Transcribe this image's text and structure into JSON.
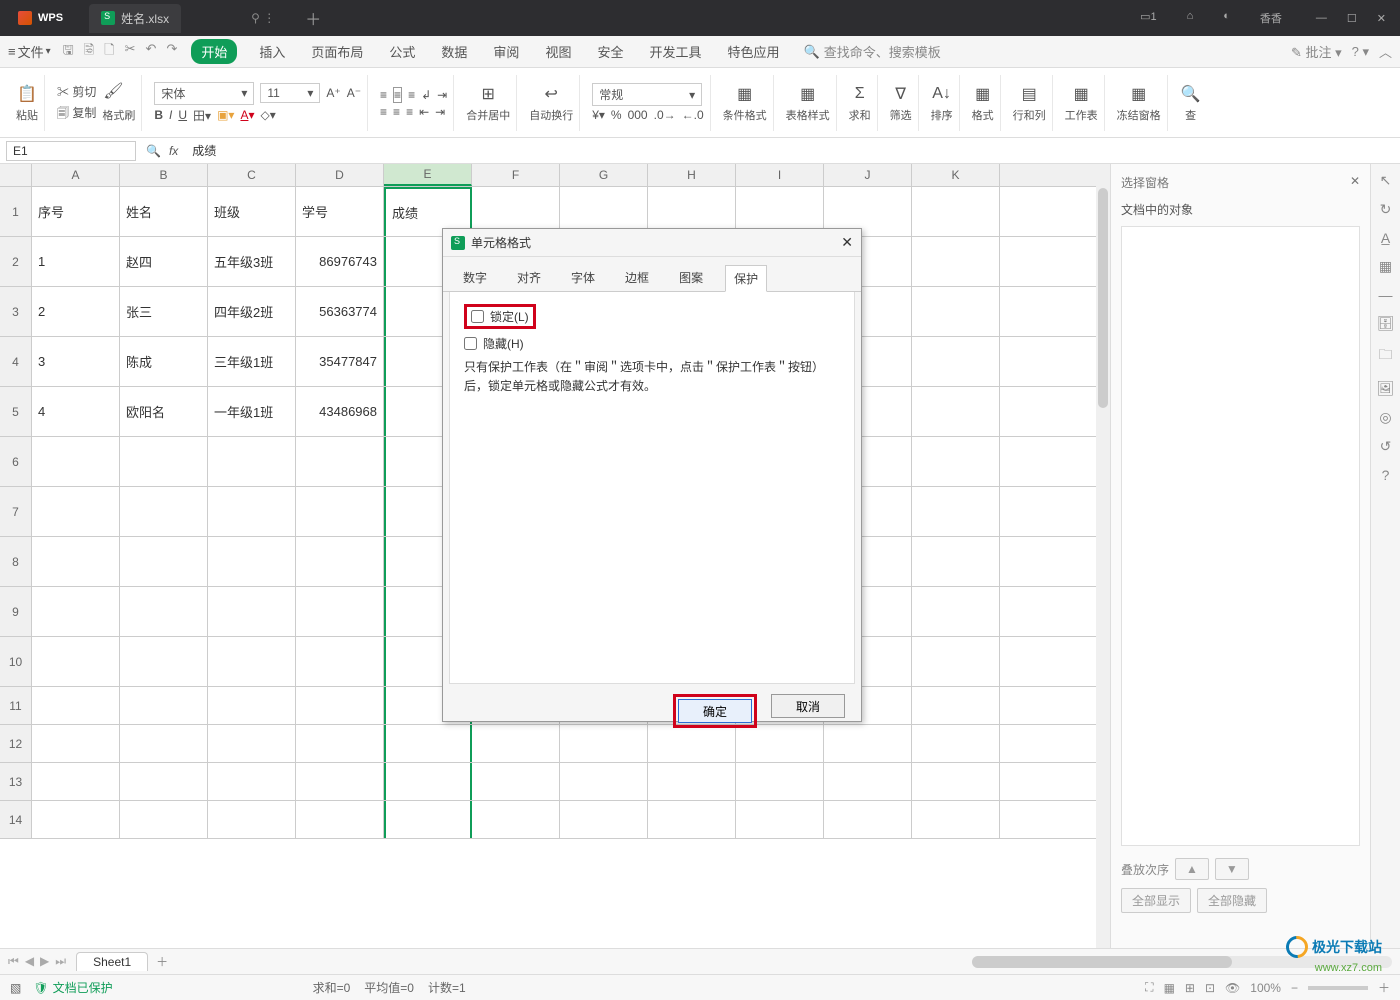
{
  "titlebar": {
    "app": "WPS",
    "filename": "姓名.xlsx",
    "user": "香香"
  },
  "menubar": {
    "file": "文件",
    "tabs": [
      "开始",
      "插入",
      "页面布局",
      "公式",
      "数据",
      "审阅",
      "视图",
      "安全",
      "开发工具",
      "特色应用"
    ],
    "active_tab": 0,
    "search_placeholder": "查找命令、搜索模板",
    "annotate": "批注"
  },
  "toolbar": {
    "paste": "粘贴",
    "cut": "剪切",
    "copy": "复制",
    "format_painter": "格式刷",
    "font_name": "宋体",
    "font_size": "11",
    "merge": "合并居中",
    "wrap": "自动换行",
    "number_format": "常规",
    "cond_format": "条件格式",
    "table_style": "表格样式",
    "sum": "求和",
    "filter": "筛选",
    "sort": "排序",
    "format": "格式",
    "rowscols": "行和列",
    "worksheet": "工作表",
    "freeze": "冻结窗格",
    "find": "查"
  },
  "formula": {
    "cell_ref": "E1",
    "value": "成绩"
  },
  "columns": [
    "A",
    "B",
    "C",
    "D",
    "E",
    "F",
    "G",
    "H",
    "I",
    "J",
    "K"
  ],
  "row_headers": [
    "1",
    "2",
    "3",
    "4",
    "5",
    "6",
    "7",
    "8",
    "9",
    "10",
    "11",
    "12",
    "13",
    "14"
  ],
  "table": {
    "headers": [
      "序号",
      "姓名",
      "班级",
      "学号",
      "成绩"
    ],
    "rows": [
      [
        "1",
        "赵四",
        "五年级3班",
        "86976743",
        ""
      ],
      [
        "2",
        "张三",
        "四年级2班",
        "56363774",
        ""
      ],
      [
        "3",
        "陈成",
        "三年级1班",
        "35477847",
        ""
      ],
      [
        "4",
        "欧阳名",
        "一年级1班",
        "43486968",
        ""
      ]
    ]
  },
  "dialog": {
    "title": "单元格格式",
    "tabs": [
      "数字",
      "对齐",
      "字体",
      "边框",
      "图案",
      "保护"
    ],
    "active": 5,
    "lock_label": "锁定(L)",
    "hidden_label": "隐藏(H)",
    "note": "只有保护工作表（在＂审阅＂选项卡中，点击＂保护工作表＂按钮）后，锁定单元格或隐藏公式才有效。",
    "ok": "确定",
    "cancel": "取消"
  },
  "sidepanel": {
    "title": "选择窗格",
    "subtitle": "文档中的对象",
    "order": "叠放次序",
    "show_all": "全部显示",
    "hide_all": "全部隐藏"
  },
  "sheets": {
    "active": "Sheet1"
  },
  "status": {
    "protect": "文档已保护",
    "sum": "求和=0",
    "avg": "平均值=0",
    "count": "计数=1",
    "zoom": "100%"
  },
  "watermark": {
    "brand": "极光下载站",
    "url": "www.xz7.com"
  }
}
